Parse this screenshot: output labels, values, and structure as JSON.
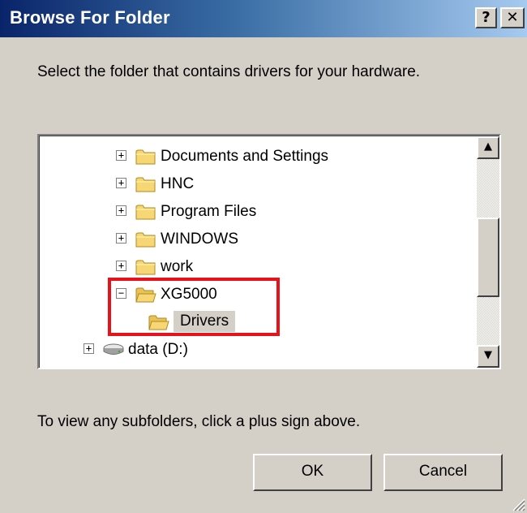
{
  "window": {
    "title": "Browse For Folder",
    "help_label": "?",
    "close_label": "✕"
  },
  "prompt": "Select the folder that contains drivers for your hardware.",
  "tree": {
    "items": [
      {
        "label": "Documents and Settings",
        "expander": "+",
        "icon": "folder-icon"
      },
      {
        "label": "HNC",
        "expander": "+",
        "icon": "folder-icon"
      },
      {
        "label": "Program Files",
        "expander": "+",
        "icon": "folder-icon"
      },
      {
        "label": "WINDOWS",
        "expander": "+",
        "icon": "folder-icon"
      },
      {
        "label": "work",
        "expander": "+",
        "icon": "folder-icon"
      },
      {
        "label": "XG5000",
        "expander": "−",
        "icon": "open-folder-icon"
      },
      {
        "label": "Drivers",
        "expander": "",
        "icon": "open-folder-icon",
        "selected": true
      },
      {
        "label": "data (D:)",
        "expander": "+",
        "icon": "drive-icon"
      }
    ]
  },
  "scrollbar": {
    "up_label": "▲",
    "down_label": "▼"
  },
  "hint": "To view any subfolders, click a plus sign above.",
  "buttons": {
    "ok": "OK",
    "cancel": "Cancel"
  },
  "colors": {
    "title_start": "#0a246a",
    "title_end": "#a6caf0",
    "dialog_bg": "#d4d0c8",
    "highlight_border": "#e8121c",
    "folder": "#f7d774"
  }
}
